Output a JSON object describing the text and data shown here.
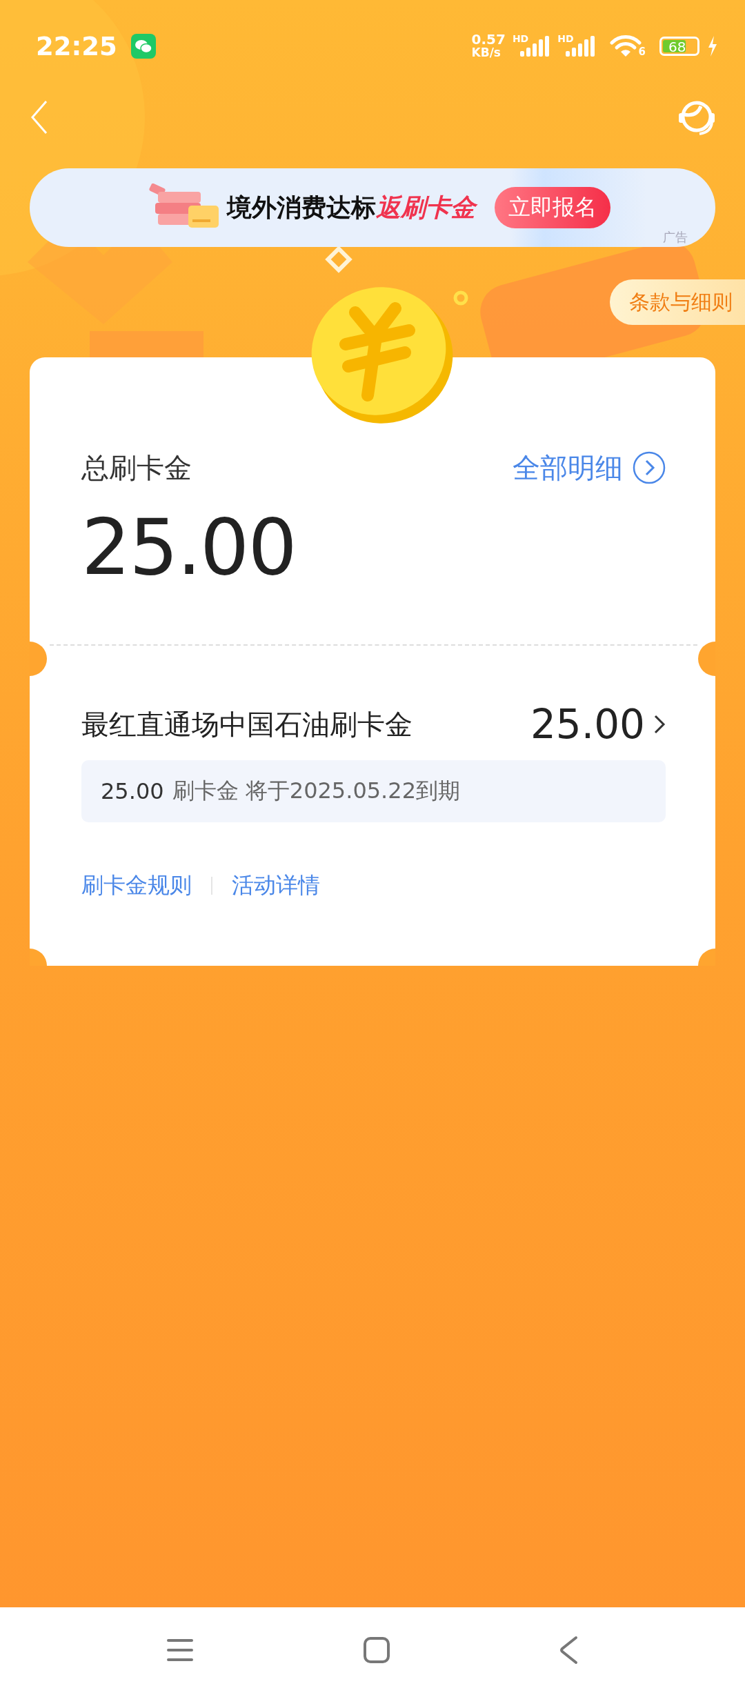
{
  "status_bar": {
    "time": "22:25",
    "net_speed": [
      "0.57",
      "KB/s"
    ],
    "signal_labels": [
      "HD",
      "HD"
    ],
    "wifi_label": "6",
    "battery": "68"
  },
  "banner": {
    "text": "境外消费达标",
    "highlight": "返刷卡金",
    "button": "立即报名",
    "ad_label": "广告"
  },
  "terms_button": "条款与细则",
  "summary": {
    "label": "总刷卡金",
    "details_link": "全部明细",
    "total": "25.00"
  },
  "items": [
    {
      "name": "最红直通场中国石油刷卡金",
      "amount": "25.00",
      "note_amount": "25.00",
      "note": "刷卡金 将于2025.05.22到期"
    }
  ],
  "links": [
    "刷卡金规则",
    "活动详情"
  ]
}
